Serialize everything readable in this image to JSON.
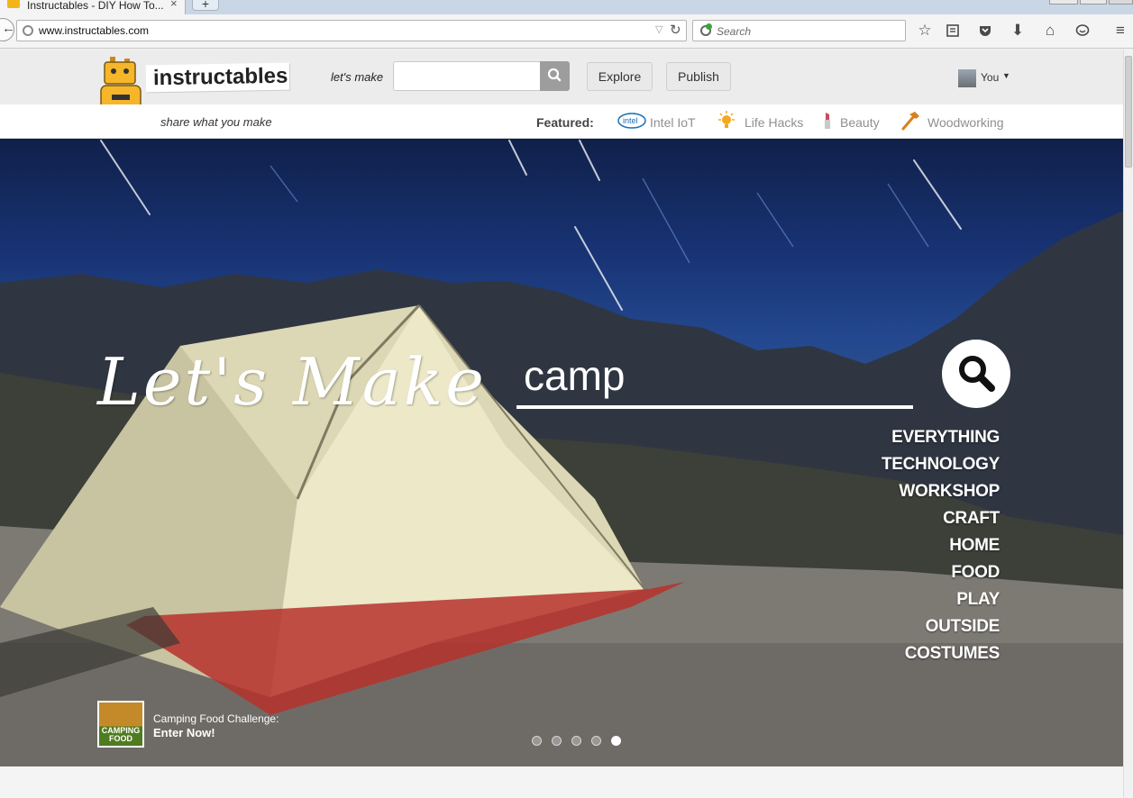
{
  "browser": {
    "tab_title": "Instructables - DIY How To...",
    "url": "www.instructables.com",
    "search_placeholder": "Search"
  },
  "header": {
    "logo_text": "instructables",
    "tagline": "share what you make",
    "lets_make_label": "let's make",
    "explore_label": "Explore",
    "publish_label": "Publish",
    "user_label": "You"
  },
  "featured": {
    "label": "Featured:",
    "items": [
      {
        "label": "Intel IoT",
        "icon": "intel-logo-icon"
      },
      {
        "label": "Life Hacks",
        "icon": "lightbulb-icon"
      },
      {
        "label": "Beauty",
        "icon": "lipstick-icon"
      },
      {
        "label": "Woodworking",
        "icon": "hammer-icon"
      }
    ]
  },
  "hero": {
    "title": "Let's Make",
    "search_value": "camp",
    "categories": [
      "EVERYTHING",
      "TECHNOLOGY",
      "WORKSHOP",
      "CRAFT",
      "HOME",
      "FOOD",
      "PLAY",
      "OUTSIDE",
      "COSTUMES"
    ],
    "promo": {
      "thumb_text": "CAMPING FOOD",
      "line1": "Camping Food Challenge:",
      "line2": "Enter Now!"
    },
    "carousel": {
      "count": 5,
      "active": 5
    }
  }
}
